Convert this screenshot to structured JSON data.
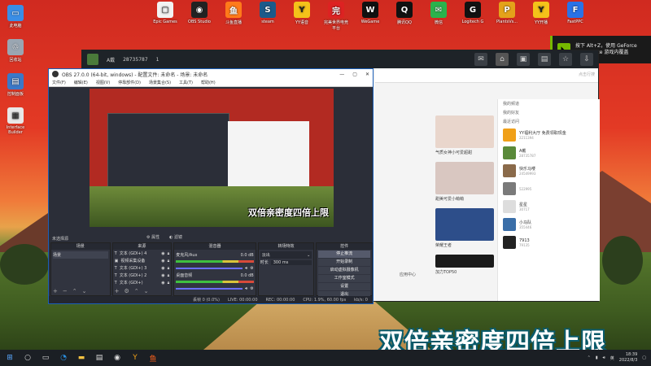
{
  "desktop": {
    "icons": [
      {
        "label": "此电脑",
        "glyph": "▭",
        "color": "#3a8ee6"
      },
      {
        "label": "回收站",
        "glyph": "♲",
        "color": "#9aa6b2"
      },
      {
        "label": "控制面板",
        "glyph": "▤",
        "color": "#3a78c8"
      },
      {
        "label": "Interface\nBuilder",
        "glyph": "▦",
        "color": "#e8e8e8"
      }
    ]
  },
  "topbar": {
    "items": [
      {
        "label": "Epic Games",
        "glyph": "▢",
        "color": "#f2f2f2"
      },
      {
        "label": "OBS Studio",
        "glyph": "◉",
        "color": "#222"
      },
      {
        "label": "斗鱼直播",
        "glyph": "鱼",
        "color": "#ff7a1a"
      },
      {
        "label": "steam",
        "glyph": "S",
        "color": "#1b5a8a"
      },
      {
        "label": "YY语音",
        "glyph": "Y",
        "color": "#f4c21a"
      },
      {
        "label": "完美世界电竞平台",
        "glyph": "完",
        "color": "#d22"
      },
      {
        "label": "WeGame",
        "glyph": "W",
        "color": "#111"
      },
      {
        "label": "腾讯QQ",
        "glyph": "Q",
        "color": "#111"
      },
      {
        "label": "微信",
        "glyph": "✉",
        "color": "#2bb24c"
      },
      {
        "label": "Logitech G",
        "glyph": "G",
        "color": "#111"
      },
      {
        "label": "PlantsVs...",
        "glyph": "P",
        "color": "#e4a21a"
      },
      {
        "label": "YY开播",
        "glyph": "Y",
        "color": "#f4c21a"
      },
      {
        "label": "FastPPC",
        "glyph": "F",
        "color": "#2a72e6"
      }
    ]
  },
  "toast": {
    "line1": "按下 Alt+Z，使用 GeForce",
    "line2": "Experience 游戏内覆盖"
  },
  "client": {
    "user_name": "A戴",
    "user_id": "28735787",
    "level": "1",
    "search_placeholder": "点击行搜",
    "cards": [
      {
        "caption": "气质女神小可爱超甜",
        "color": "#e9d6cc"
      },
      {
        "caption": "甜美可爱小萌萌",
        "color": "#d9c7c1"
      },
      {
        "caption": "荣耀王者",
        "color": "#2d4e8a"
      },
      {
        "caption": "加力TOP50",
        "color": "#1a1a1a"
      }
    ],
    "side_header_1": "我的频道",
    "side_header_2": "我的好友",
    "side_header_3": "最近访问",
    "friends": [
      {
        "name": "YY福利大厅 免费领取现金",
        "id": "2211394",
        "color": "#f0a018"
      },
      {
        "name": "A戴",
        "id": "28735787",
        "color": "#5a8a3a"
      },
      {
        "name": "快乐马喽",
        "id": "24549993",
        "color": "#8a6a4a"
      },
      {
        "name": "",
        "id": "522995",
        "color": "#7a7a7a"
      },
      {
        "name": "星星",
        "id": "30717",
        "color": "#ddd"
      },
      {
        "name": "小马队",
        "id": "355446",
        "color": "#3a6ea8"
      },
      {
        "name": "7913",
        "id": "79135",
        "color": "#222"
      }
    ],
    "bottom_tab": "应用中心"
  },
  "obs": {
    "title": "OBS 27.0.0 (64-bit, windows) - 配置文件: 未命名 - 场景: 未命名",
    "menu": [
      "文件(F)",
      "编辑(E)",
      "视图(V)",
      "停靠部件(D)",
      "场景集合(S)",
      "工具(T)",
      "帮助(H)"
    ],
    "preview_caption": "双倍亲密度四倍上限",
    "no_source_label": "未选择源",
    "tool_properties": "属性",
    "tool_filters": "滤镜",
    "docks": {
      "scenes": {
        "title": "场景",
        "items": [
          "场景"
        ]
      },
      "sources": {
        "title": "来源",
        "items": [
          "文本 (GDI+) 4",
          "视频采集设备",
          "文本 (GDI+) 3",
          "文本 (GDI+) 2",
          "文本 (GDI+)",
          "窗口采集"
        ]
      },
      "mixer": {
        "title": "混音器",
        "channels": [
          {
            "name": "麦克风/Aux",
            "db": "0.0 dB"
          },
          {
            "name": "桌面音频",
            "db": "0.0 dB"
          }
        ]
      },
      "transitions": {
        "title": "转场特效",
        "mode": "淡出",
        "duration_label": "时长",
        "duration": "300 ms"
      },
      "controls": {
        "title": "控件",
        "buttons": [
          "停止推流",
          "开始录制",
          "启动虚拟摄像机",
          "工作室模式",
          "设置",
          "退出"
        ]
      }
    },
    "status": {
      "dropped": "丢帧 0 (0.0%)",
      "live": "LIVE: 00:00:00",
      "rec": "REC: 00:00:00",
      "cpu": "CPU: 1.9%, 60.00 fps",
      "bitrate": "kb/s: 0"
    }
  },
  "big_caption": "双倍亲密度四倍上限",
  "taskbar": {
    "lang": "英",
    "time": "18:39",
    "date": "2022/8/3"
  }
}
